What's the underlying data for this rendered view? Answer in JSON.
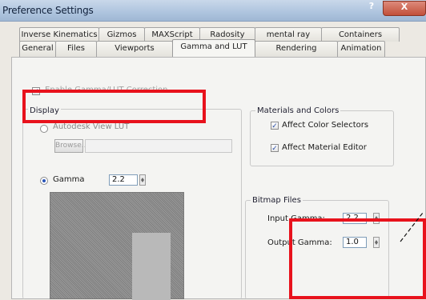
{
  "window": {
    "title": "Preference Settings",
    "help": "?",
    "close": "X"
  },
  "tabs_row1": [
    "Inverse Kinematics",
    "Gizmos",
    "MAXScript",
    "Radosity",
    "mental ray",
    "Containers"
  ],
  "tabs_row2": [
    "General",
    "Files",
    "Viewports",
    "Gamma and LUT",
    "Rendering",
    "Animation"
  ],
  "active_tab": "Gamma and LUT",
  "enable_gamma": {
    "label": "Enable Gamma/LUT Correction",
    "checked": true
  },
  "display": {
    "group_label": "Display",
    "lut_label": "Autodesk View LUT",
    "browse_label": "Browse...",
    "gamma_label": "Gamma",
    "gamma_value": "2.2"
  },
  "materials": {
    "group_label": "Materials and Colors",
    "affect_color_selectors": "Affect Color Selectors",
    "affect_material_editor": "Affect Material Editor"
  },
  "bitmap": {
    "group_label": "Bitmap Files",
    "input_gamma_label": "Input Gamma:",
    "input_gamma_value": "2.2",
    "output_gamma_label": "Output Gamma:",
    "output_gamma_value": "1.0"
  },
  "colors": {
    "highlight": "#e8121c",
    "title_bar": "#aec4de",
    "active_radio": "#2a55b8"
  }
}
